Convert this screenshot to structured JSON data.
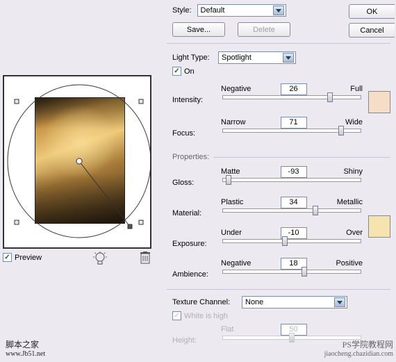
{
  "top": {
    "style_label": "Style:",
    "style_value": "Default",
    "save": "Save...",
    "delete": "Delete",
    "ok": "OK",
    "cancel": "Cancel"
  },
  "light": {
    "type_label": "Light Type:",
    "type_value": "Spotlight",
    "on_label": "On",
    "intensity": {
      "label": "Intensity:",
      "left": "Negative",
      "right": "Full",
      "value": "26",
      "pct": 78
    },
    "focus": {
      "label": "Focus:",
      "left": "Narrow",
      "right": "Wide",
      "value": "71",
      "pct": 86
    },
    "swatch_color": "#f5ddc7"
  },
  "props": {
    "legend": "Properties:",
    "gloss": {
      "label": "Gloss:",
      "left": "Matte",
      "right": "Shiny",
      "value": "-93",
      "pct": 4
    },
    "material": {
      "label": "Material:",
      "left": "Plastic",
      "right": "Metallic",
      "value": "34",
      "pct": 67
    },
    "exposure": {
      "label": "Exposure:",
      "left": "Under",
      "right": "Over",
      "value": "-10",
      "pct": 45
    },
    "ambience": {
      "label": "Ambience:",
      "left": "Negative",
      "right": "Positive",
      "value": "18",
      "pct": 59
    },
    "swatch_color": "#f5e3b0"
  },
  "texture": {
    "channel_label": "Texture Channel:",
    "channel_value": "None",
    "white_label": "White is high",
    "height": {
      "label": "Height:",
      "left": "Flat",
      "right": "",
      "value": "50",
      "pct": 50
    }
  },
  "preview": {
    "label": "Preview"
  },
  "footer": {
    "left1": "脚本之家",
    "left2": "www.Jb51.net",
    "right1": "PS学院教程网",
    "right2": "jiaocheng.chazidian.com"
  }
}
